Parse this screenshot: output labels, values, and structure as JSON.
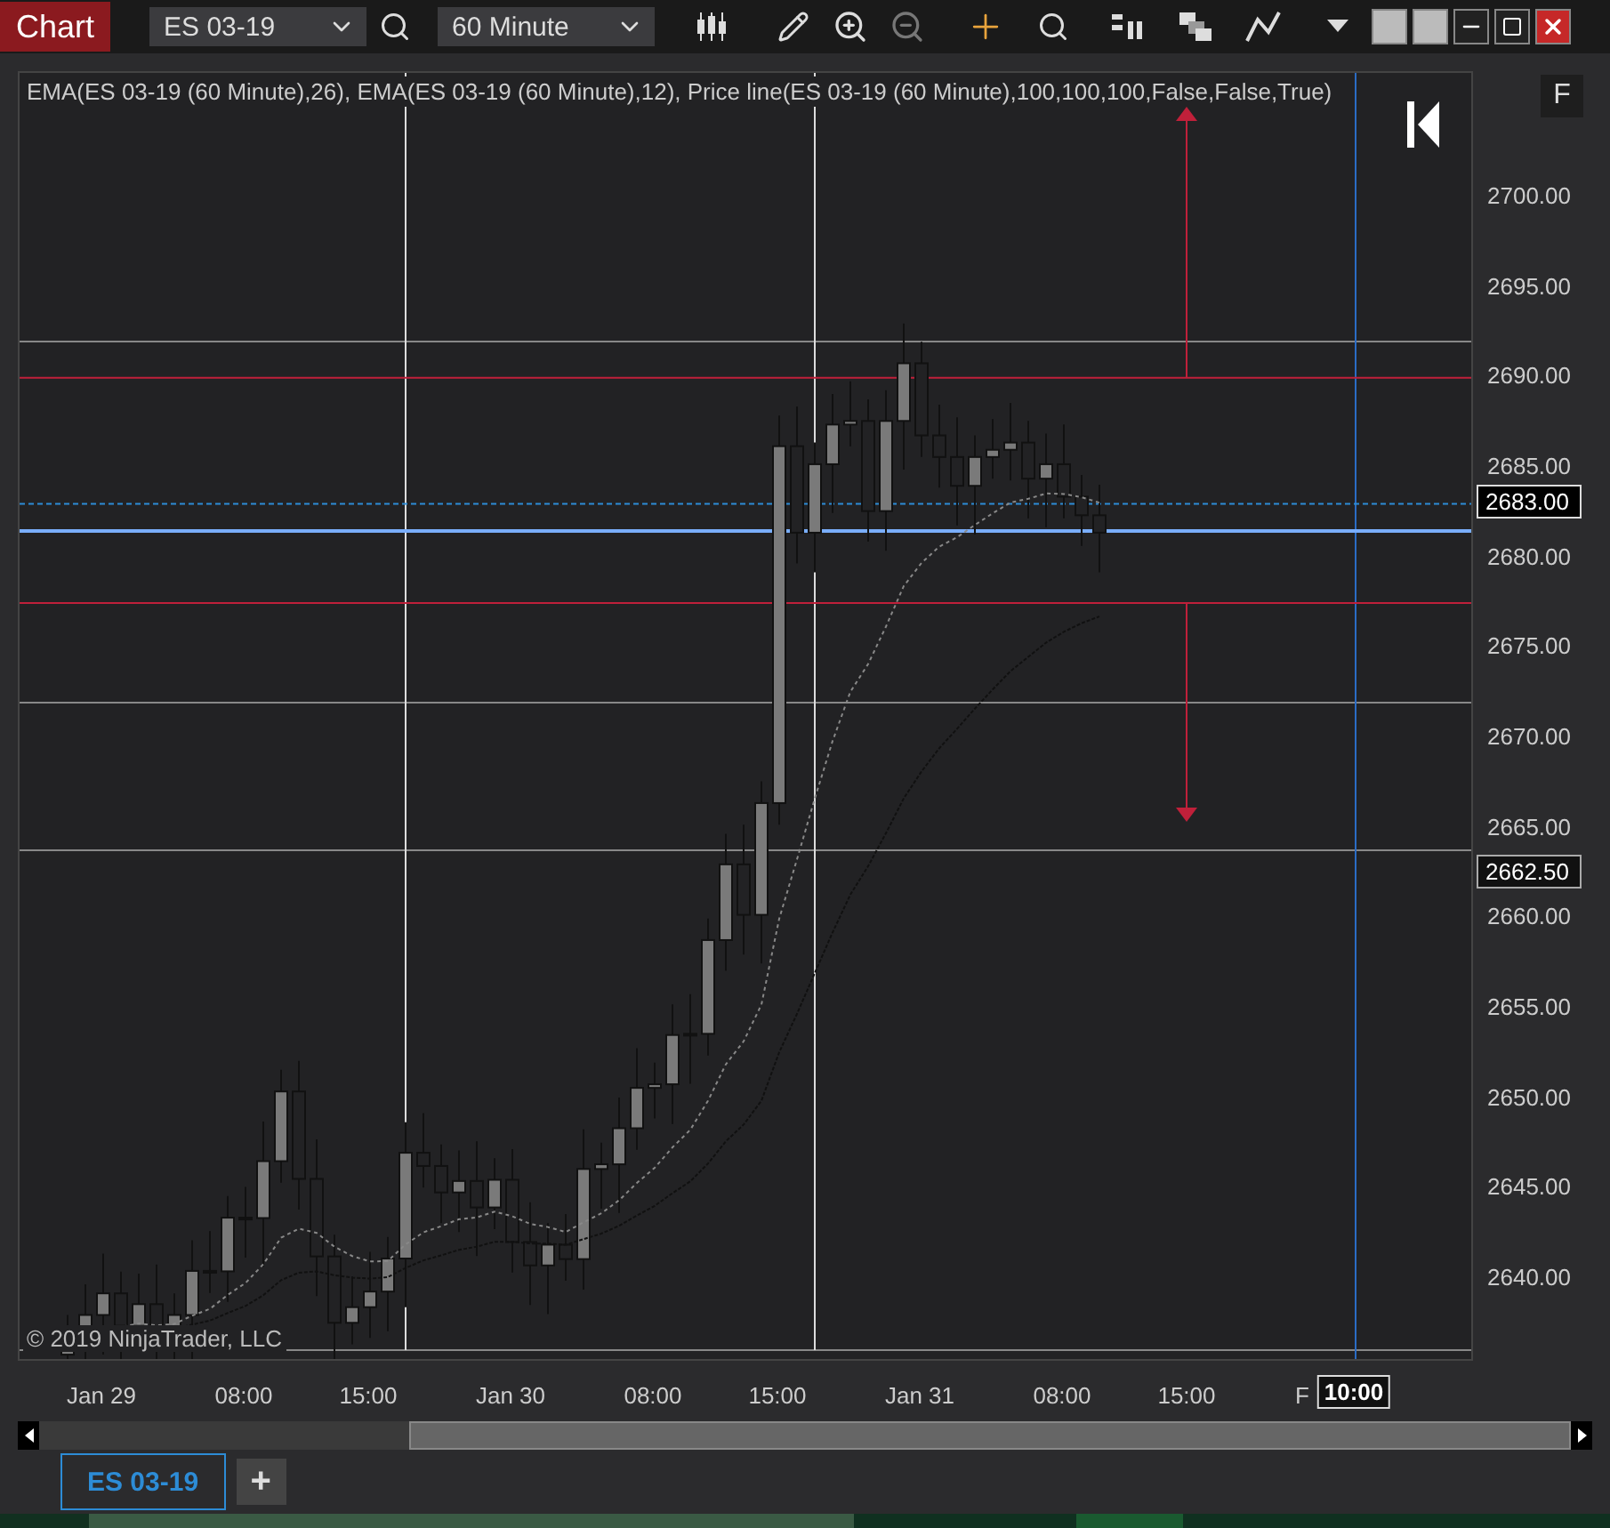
{
  "toolbar": {
    "title": "Chart",
    "instrument": "ES 03-19",
    "interval": "60 Minute"
  },
  "legend": "EMA(ES 03-19 (60 Minute),26), EMA(ES 03-19 (60 Minute),12), Price line(ES 03-19 (60 Minute),100,100,100,False,False,True)",
  "panel_button": "F",
  "copyright": "© 2019 NinjaTrader, LLC",
  "y_axis": [
    "2700.00",
    "2695.00",
    "2690.00",
    "2685.00",
    "2680.00",
    "2675.00",
    "2670.00",
    "2665.00",
    "2660.00",
    "2655.00",
    "2650.00",
    "2645.00",
    "2640.00"
  ],
  "price_markers": [
    {
      "label": "2683.00",
      "kind": "last"
    },
    {
      "label": "2662.50",
      "kind": "line"
    }
  ],
  "x_axis": [
    "Jan 29",
    "08:00",
    "15:00",
    "Jan 30",
    "08:00",
    "15:00",
    "Jan 31",
    "08:00",
    "15:00",
    "F"
  ],
  "crosshair_time": "10:00",
  "tabs": [
    {
      "label": "ES 03-19",
      "selected": true
    }
  ],
  "add_tab": "+"
}
